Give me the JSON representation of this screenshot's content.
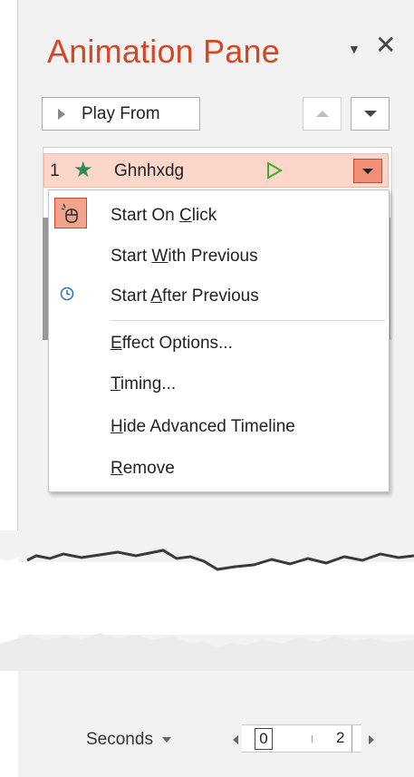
{
  "pane": {
    "title": "Animation Pane",
    "menu_glyph": "▼",
    "close_glyph": "✕"
  },
  "toolbar": {
    "play_from_label": "Play From",
    "move_up_icon": "triangle-up",
    "move_down_icon": "triangle-down"
  },
  "animation_item": {
    "number": "1",
    "effect_icon": "star",
    "name": "Ghnhxdg",
    "play_icon": "▷"
  },
  "context_menu": {
    "items": [
      {
        "pre": "Start On ",
        "key": "C",
        "post": "lick",
        "icon": "mouse-click-icon",
        "selected": true
      },
      {
        "pre": "Start ",
        "key": "W",
        "post": "ith Previous",
        "icon": null
      },
      {
        "pre": "Start ",
        "key": "A",
        "post": "fter Previous",
        "icon": "clock-icon"
      },
      {
        "pre": "",
        "key": "E",
        "post": "ffect Options...",
        "icon": null
      },
      {
        "pre": "",
        "key": "T",
        "post": "iming...",
        "icon": null
      },
      {
        "pre": "",
        "key": "H",
        "post": "ide Advanced Timeline",
        "icon": null
      },
      {
        "pre": "",
        "key": "R",
        "post": "emove",
        "icon": null
      }
    ]
  },
  "timeline": {
    "units_label": "Seconds",
    "ruler_start": "0",
    "ruler_mark": "2"
  },
  "colors": {
    "title": "#d24726",
    "selected_row": "#fcd6c8",
    "accent_button": "#f08f76",
    "star": "#2e8b57",
    "play_green": "#3fae2a",
    "clock": "#2a6ebb"
  }
}
